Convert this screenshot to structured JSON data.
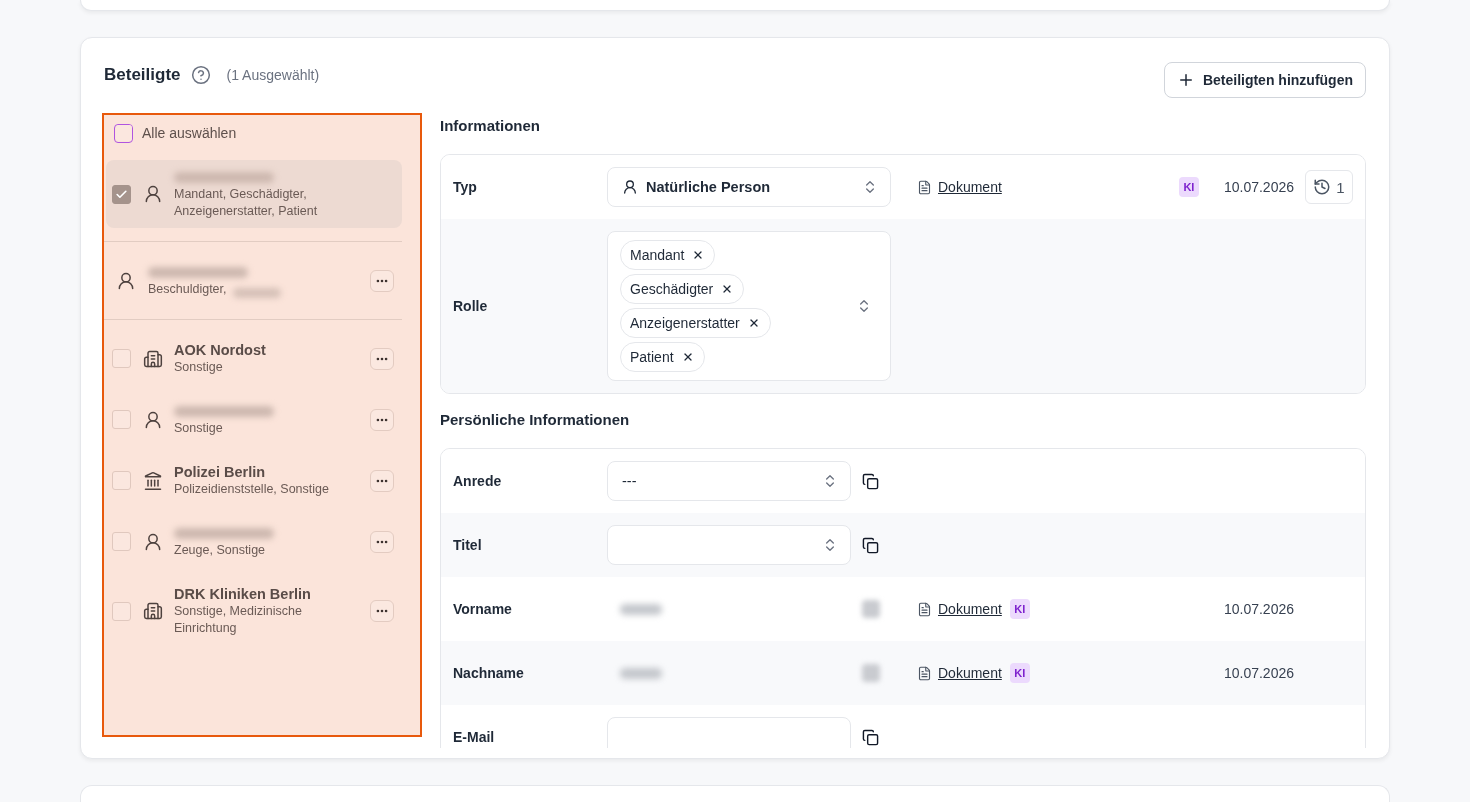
{
  "section": {
    "title": "Beteiligte",
    "selection_count": "(1 Ausgewählt)",
    "add_button": "Beteiligten hinzufügen"
  },
  "participants": {
    "select_all": {
      "label": "Alle auswählen",
      "checked": false,
      "focused": true
    },
    "groups": [
      {
        "items": [
          {
            "kind": "person",
            "redacted": true,
            "roles": "Mandant, Geschädigter, Anzeigenerstatter, Patient",
            "roles_redacted": false,
            "selectable": true,
            "checked": true,
            "selected": true,
            "menu": false
          }
        ]
      },
      {
        "items": [
          {
            "kind": "person",
            "redacted": true,
            "roles": "Beschuldigter,",
            "roles_redacted": true,
            "selectable": false,
            "selected": false,
            "menu": true
          }
        ]
      },
      {
        "items": [
          {
            "kind": "organization",
            "name": "AOK Nordost",
            "redacted": false,
            "roles": "Sonstige",
            "roles_redacted": false,
            "selectable": true,
            "checked": false,
            "selected": false,
            "menu": true
          },
          {
            "kind": "person",
            "redacted": true,
            "roles": "Sonstige",
            "roles_redacted": false,
            "selectable": true,
            "checked": false,
            "selected": false,
            "menu": true
          },
          {
            "kind": "authority",
            "name": "Polizei Berlin",
            "redacted": false,
            "roles": "Polizeidienststelle, Sonstige",
            "roles_redacted": false,
            "selectable": true,
            "checked": false,
            "selected": false,
            "menu": true
          },
          {
            "kind": "person",
            "redacted": true,
            "roles": "Zeuge, Sonstige",
            "roles_redacted": false,
            "selectable": true,
            "checked": false,
            "selected": false,
            "menu": true
          },
          {
            "kind": "organization",
            "name": "DRK Kliniken Berlin",
            "redacted": false,
            "roles": "Sonstige, Medizinische Einrichtung",
            "roles_redacted": false,
            "selectable": true,
            "checked": false,
            "selected": false,
            "menu": true
          }
        ]
      }
    ]
  },
  "information": {
    "title": "Informationen",
    "rows": [
      {
        "kind": "type-select",
        "label": "Typ",
        "value": "Natürliche Person",
        "source": {
          "link": "Dokument",
          "badge": "KI",
          "date": "10.07.2026",
          "history": "1"
        }
      },
      {
        "kind": "tags",
        "label": "Rolle",
        "tags": [
          "Mandant",
          "Geschädigter",
          "Anzeigenerstatter",
          "Patient"
        ]
      }
    ]
  },
  "personal": {
    "title": "Persönliche Informationen",
    "rows": [
      {
        "kind": "select",
        "label": "Anrede",
        "value": "---"
      },
      {
        "kind": "select",
        "label": "Titel"
      },
      {
        "kind": "redacted",
        "label": "Vorname",
        "source": {
          "link": "Dokument",
          "badge": "KI",
          "date": "10.07.2026"
        }
      },
      {
        "kind": "redacted",
        "label": "Nachname",
        "source": {
          "link": "Dokument",
          "badge": "KI",
          "date": "10.07.2026"
        }
      },
      {
        "kind": "input",
        "label": "E-Mail"
      }
    ]
  }
}
